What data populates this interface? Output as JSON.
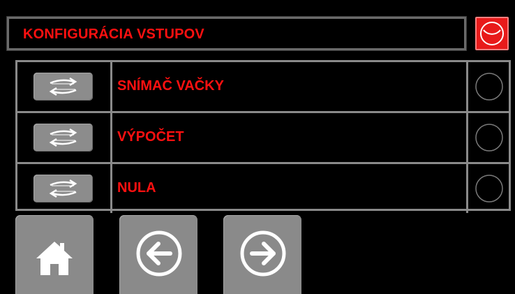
{
  "header": {
    "title": "KONFIGURÁCIA VSTUPOV",
    "alarm_icon": "alarm-circle-icon"
  },
  "inputs": [
    {
      "label": "SNÍMAČ VAČKY",
      "button_icon": "swap-arrows-icon",
      "status": "off"
    },
    {
      "label": "VÝPOČET",
      "button_icon": "swap-arrows-icon",
      "status": "off"
    },
    {
      "label": "NULA",
      "button_icon": "swap-arrows-icon",
      "status": "off"
    }
  ],
  "navigation": {
    "home_icon": "home-icon",
    "back_icon": "arrow-left-circle-icon",
    "forward_icon": "arrow-right-circle-icon"
  },
  "colors": {
    "text_accent": "#ff1010",
    "alarm_bg": "#e81a1a",
    "button_gray": "#8a8a8a",
    "border_gray": "#8a8a8a",
    "background": "#000000"
  }
}
